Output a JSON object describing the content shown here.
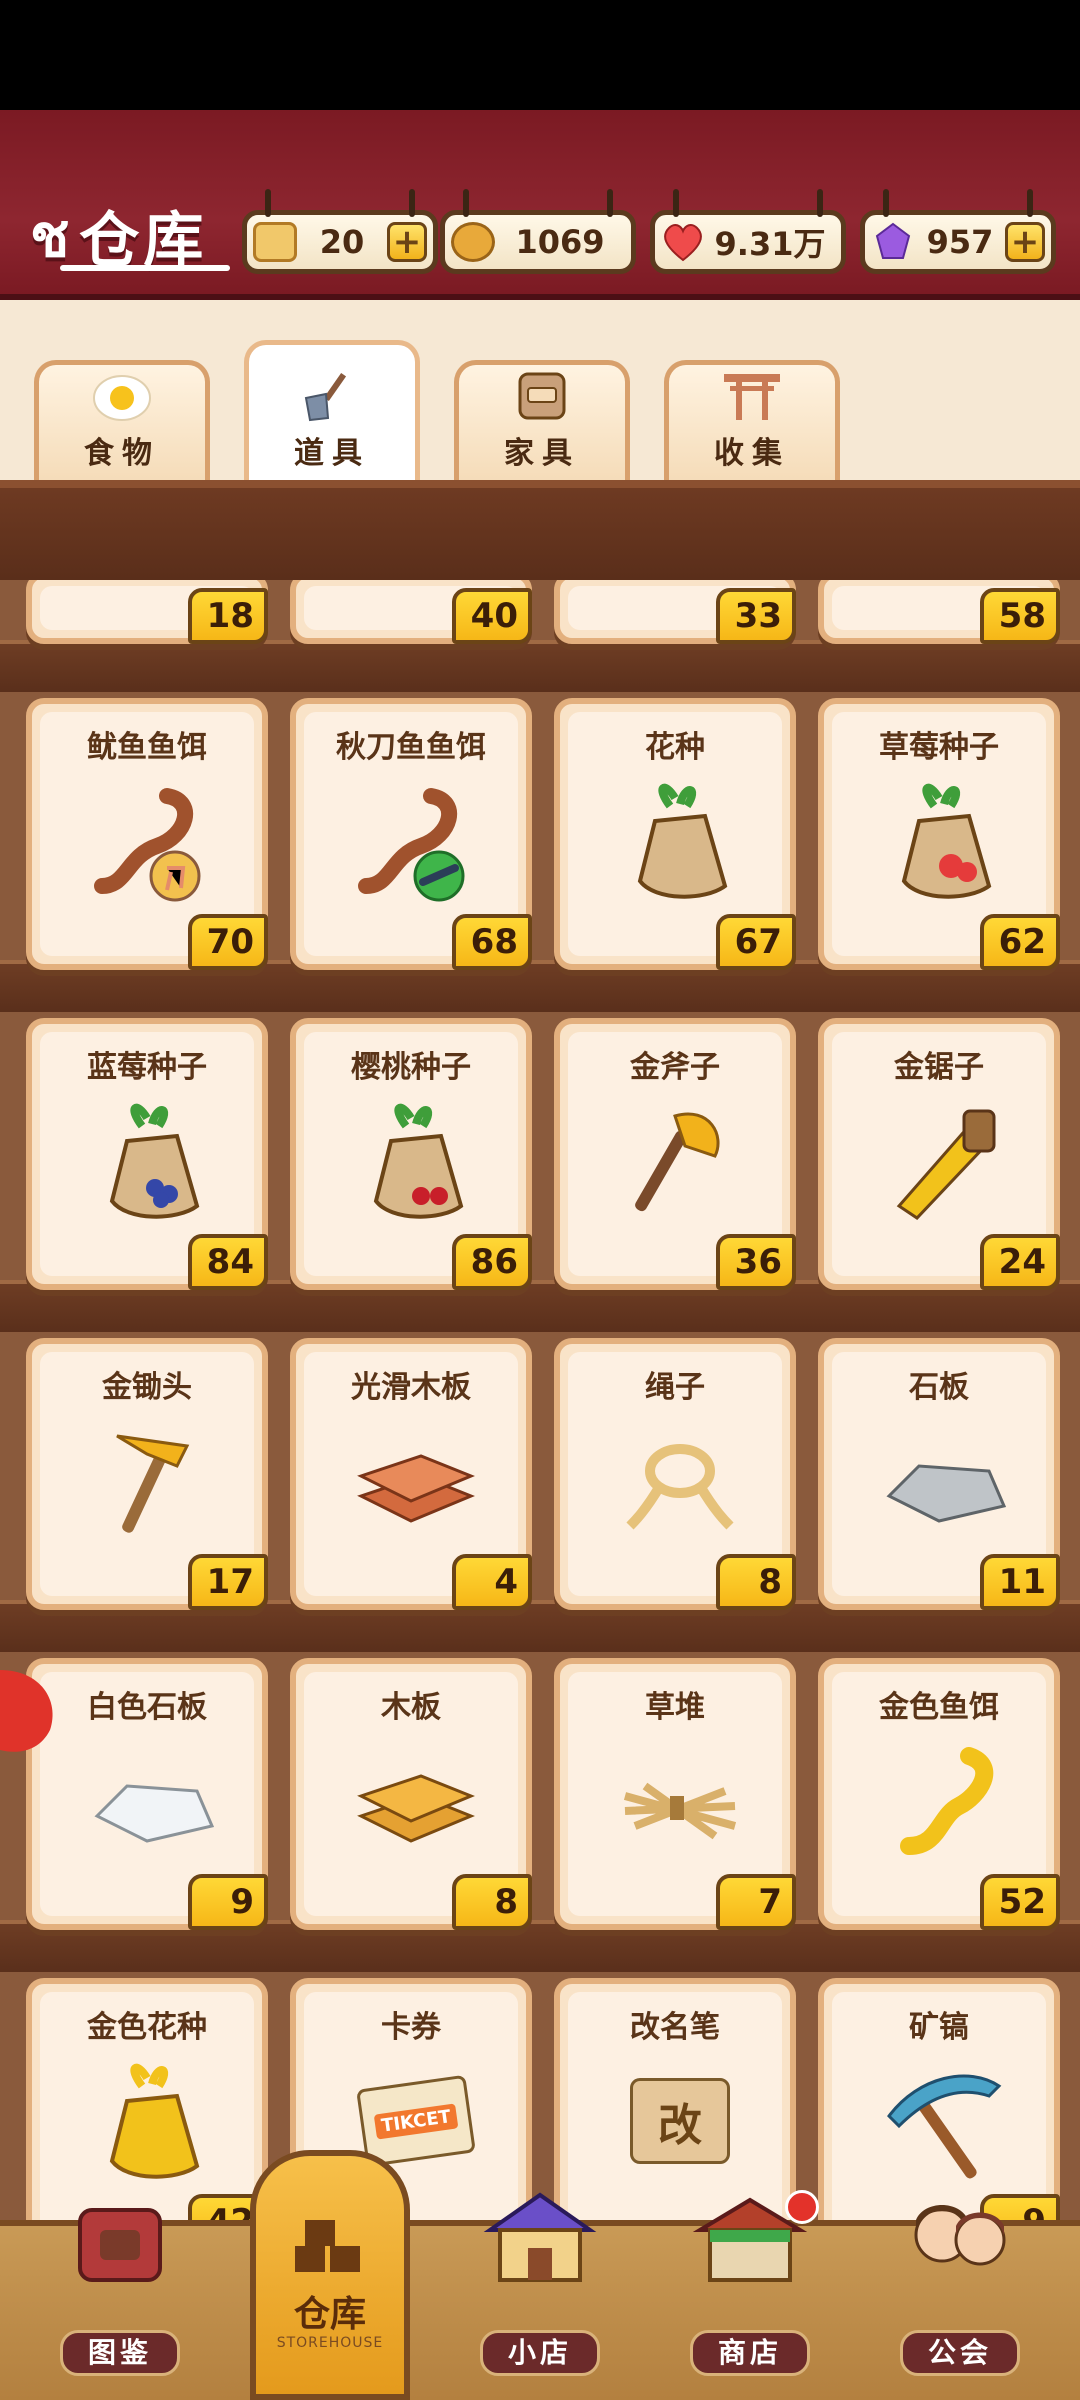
{
  "header": {
    "title": "仓库",
    "currencies": [
      {
        "name": "ticket-icon",
        "value": "20",
        "has_plus": true,
        "icon_text": "",
        "color": "#f1c86a"
      },
      {
        "name": "coin-icon",
        "value": "1069",
        "has_plus": false,
        "icon_text": "",
        "color": "#e8a93a"
      },
      {
        "name": "heart-icon",
        "value": "9.31万",
        "has_plus": false,
        "icon_text": "",
        "color": "#ef4b4b"
      },
      {
        "name": "gem-icon",
        "value": "957",
        "has_plus": true,
        "icon_text": "",
        "color": "#9b5be0"
      }
    ]
  },
  "tabs": [
    {
      "label": "食物",
      "icon": "fried-egg-icon",
      "active": false
    },
    {
      "label": "道具",
      "icon": "shovel-icon",
      "active": true
    },
    {
      "label": "家具",
      "icon": "cabinet-icon",
      "active": false
    },
    {
      "label": "收集",
      "icon": "torii-gate-icon",
      "active": false
    }
  ],
  "partial_row_counts": [
    "18",
    "40",
    "33",
    "58"
  ],
  "items": [
    {
      "name": "鱿鱼鱼饵",
      "count": "70",
      "icon": "squid-bait-icon"
    },
    {
      "name": "秋刀鱼鱼饵",
      "count": "68",
      "icon": "saury-bait-icon"
    },
    {
      "name": "花种",
      "count": "67",
      "icon": "flower-seed-bag-icon"
    },
    {
      "name": "草莓种子",
      "count": "62",
      "icon": "strawberry-seed-bag-icon"
    },
    {
      "name": "蓝莓种子",
      "count": "84",
      "icon": "blueberry-seed-bag-icon"
    },
    {
      "name": "樱桃种子",
      "count": "86",
      "icon": "cherry-seed-bag-icon"
    },
    {
      "name": "金斧子",
      "count": "36",
      "icon": "gold-axe-icon"
    },
    {
      "name": "金锯子",
      "count": "24",
      "icon": "gold-saw-icon"
    },
    {
      "name": "金锄头",
      "count": "17",
      "icon": "gold-hoe-icon"
    },
    {
      "name": "光滑木板",
      "count": "4",
      "icon": "smooth-plank-icon"
    },
    {
      "name": "绳子",
      "count": "8",
      "icon": "rope-icon"
    },
    {
      "name": "石板",
      "count": "11",
      "icon": "stone-slab-icon"
    },
    {
      "name": "白色石板",
      "count": "9",
      "icon": "white-stone-slab-icon"
    },
    {
      "name": "木板",
      "count": "8",
      "icon": "wood-plank-icon"
    },
    {
      "name": "草堆",
      "count": "7",
      "icon": "haystack-icon"
    },
    {
      "name": "金色鱼饵",
      "count": "52",
      "icon": "gold-bait-icon"
    },
    {
      "name": "金色花种",
      "count": "42",
      "icon": "gold-flower-seed-icon"
    },
    {
      "name": "卡券",
      "count": "",
      "icon": "ticket-card-icon",
      "ticket_text": "TIKCET"
    },
    {
      "name": "改名笔",
      "count": "",
      "icon": "rename-pen-icon",
      "stamp_text": "改"
    },
    {
      "name": "矿镐",
      "count": "9",
      "icon": "pickaxe-icon"
    }
  ],
  "bottom_nav": [
    {
      "label": "图鉴",
      "icon": "encyclopedia-icon",
      "active": false
    },
    {
      "label": "仓库",
      "sub": "STOREHOUSE",
      "icon": "storehouse-icon",
      "active": true
    },
    {
      "label": "小店",
      "icon": "small-shop-icon",
      "active": false
    },
    {
      "label": "商店",
      "icon": "store-icon",
      "active": false,
      "notification": true
    },
    {
      "label": "公会",
      "icon": "guild-icon",
      "active": false
    }
  ]
}
